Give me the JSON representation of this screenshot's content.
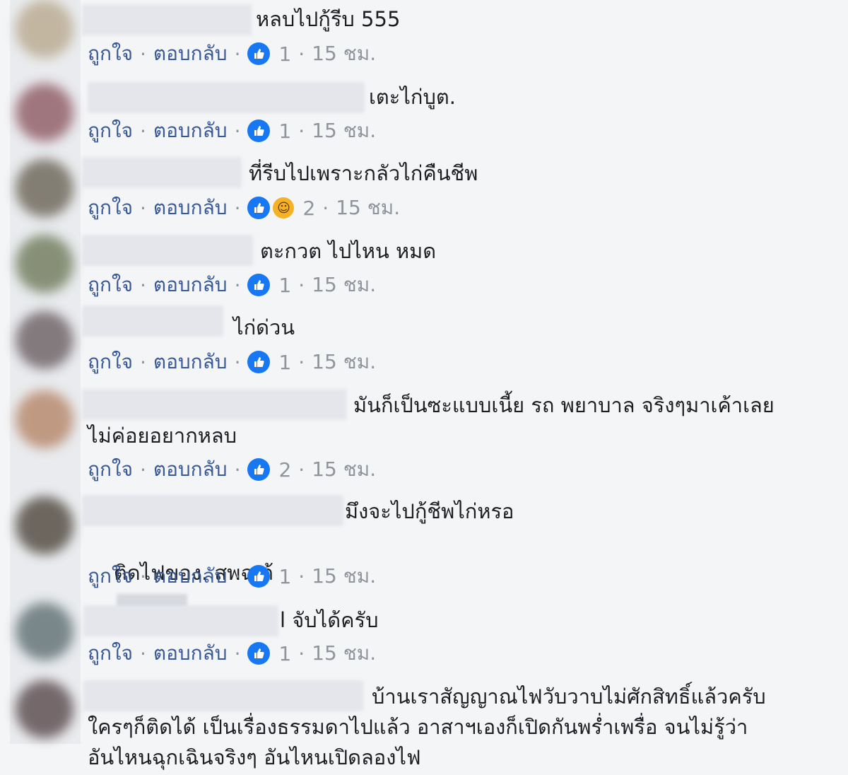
{
  "colors": {
    "link": "#385898",
    "meta": "#90949c",
    "like": "#1877f2",
    "haha": "#f7b125"
  },
  "actions": {
    "like_label": "ถูกใจ",
    "reply_label": "ตอบกลับ",
    "time": "15 ชม."
  },
  "comments": [
    {
      "text": "หลบไปกู้รีบ 555",
      "reactions": [
        "like-icon"
      ],
      "count": "1"
    },
    {
      "text": "เตะไก่บูต.",
      "reactions": [
        "like-icon"
      ],
      "count": "1"
    },
    {
      "text": "ที่รีบไปเพราะกลัวไก่คืนชีพ",
      "reactions": [
        "like-icon",
        "haha-icon"
      ],
      "count": "2"
    },
    {
      "text": "ตะกวต ไปไหน หมด",
      "reactions": [
        "like-icon"
      ],
      "count": "1"
    },
    {
      "text": "ไก่ด่วน",
      "reactions": [
        "like-icon"
      ],
      "count": "1"
    },
    {
      "text": "มันก็เป็นซะแบบเนี้ย รถ พยาบาล จริงๆมาเค้าเลย",
      "text2": "ไม่ค่อยอยากหลบ",
      "reactions": [
        "like-icon"
      ],
      "count": "2"
    },
    {
      "text": "มึงจะไปกู้ชีพไก่หรอ",
      "text2": "ติดไฟของ. สพฉ ถ้",
      "reactions": [
        "like-icon"
      ],
      "count": "1"
    },
    {
      "text": "l จับได้ครับ",
      "reactions": [
        "like-icon"
      ],
      "count": "1"
    },
    {
      "text": "บ้านเราสัญญาณไฟวับวาบไม่ศักสิทธิ์แล้วครับ",
      "text2": "ใครๆก็ติดได้ เป็นเรื่องธรรมดาไปแล้ว อาสาฯเองก็เปิดกันพร่ำเพรื่อ จนไม่รู้ว่า",
      "text3": "อันไหนฉุกเฉินจริงๆ อันไหนเปิดลองไฟ"
    }
  ]
}
